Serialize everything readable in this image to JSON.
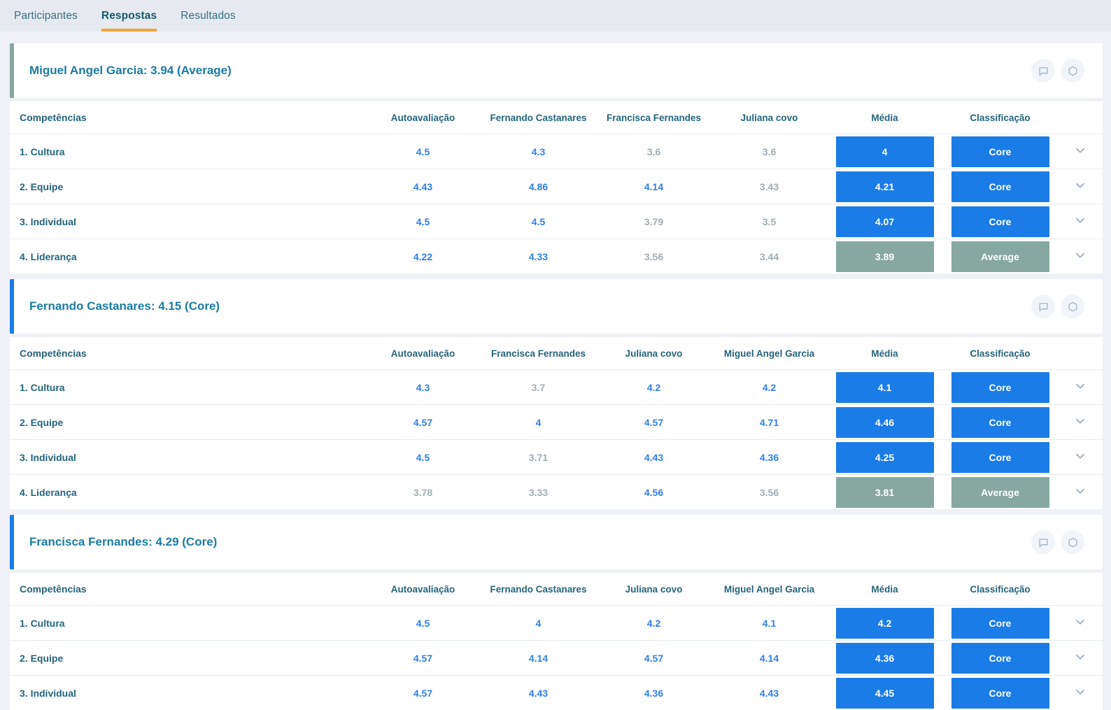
{
  "tab_bar": {
    "tabs": [
      {
        "label": "Participantes",
        "active": false
      },
      {
        "label": "Respostas",
        "active": true
      },
      {
        "label": "Resultados",
        "active": false
      }
    ]
  },
  "colors": {
    "core_blue": "#1b7ce8",
    "average_sage": "#86a8a1",
    "active_tab_underline": "#f6a335",
    "score_high": "#3080e8",
    "score_low": "#9fadb4"
  },
  "sections": [
    {
      "title": "Miguel Angel Garcia: 3.94 (Average)",
      "overall_classification": "Average",
      "header_icons": [
        "comment-icon",
        "hexagon-icon"
      ],
      "columns": {
        "competencias": "Competências",
        "evaluators": [
          "Autoavaliação",
          "Fernando Castanares",
          "Francisca Fernandes",
          "Juliana covo"
        ],
        "media": "Média",
        "classificacao": "Classificação"
      },
      "rows": [
        {
          "label": "1. Cultura",
          "values": [
            4.5,
            4.3,
            3.6,
            3.6
          ],
          "media": 4,
          "classification": "Core"
        },
        {
          "label": "2. Equipe",
          "values": [
            4.43,
            4.86,
            4.14,
            3.43
          ],
          "media": 4.21,
          "classification": "Core"
        },
        {
          "label": "3. Individual",
          "values": [
            4.5,
            4.5,
            3.79,
            3.5
          ],
          "media": 4.07,
          "classification": "Core"
        },
        {
          "label": "4. Liderança",
          "values": [
            4.22,
            4.33,
            3.56,
            3.44
          ],
          "media": 3.89,
          "classification": "Average"
        }
      ]
    },
    {
      "title": "Fernando Castanares: 4.15 (Core)",
      "overall_classification": "Core",
      "header_icons": [
        "comment-icon",
        "hexagon-icon"
      ],
      "columns": {
        "competencias": "Competências",
        "evaluators": [
          "Autoavaliação",
          "Francisca Fernandes",
          "Juliana covo",
          "Miguel Angel Garcia"
        ],
        "media": "Média",
        "classificacao": "Classificação"
      },
      "rows": [
        {
          "label": "1. Cultura",
          "values": [
            4.3,
            3.7,
            4.2,
            4.2
          ],
          "media": 4.1,
          "classification": "Core"
        },
        {
          "label": "2. Equipe",
          "values": [
            4.57,
            4,
            4.57,
            4.71
          ],
          "media": 4.46,
          "classification": "Core"
        },
        {
          "label": "3. Individual",
          "values": [
            4.5,
            3.71,
            4.43,
            4.36
          ],
          "media": 4.25,
          "classification": "Core"
        },
        {
          "label": "4. Liderança",
          "values": [
            3.78,
            3.33,
            4.56,
            3.56
          ],
          "media": 3.81,
          "classification": "Average"
        }
      ]
    },
    {
      "title": "Francisca Fernandes: 4.29 (Core)",
      "overall_classification": "Core",
      "header_icons": [
        "comment-icon",
        "hexagon-icon"
      ],
      "columns": {
        "competencias": "Competências",
        "evaluators": [
          "Autoavaliação",
          "Fernando Castanares",
          "Juliana covo",
          "Miguel Angel Garcia"
        ],
        "media": "Média",
        "classificacao": "Classificação"
      },
      "rows": [
        {
          "label": "1. Cultura",
          "values": [
            4.5,
            4,
            4.2,
            4.1
          ],
          "media": 4.2,
          "classification": "Core"
        },
        {
          "label": "2. Equipe",
          "values": [
            4.57,
            4.14,
            4.57,
            4.14
          ],
          "media": 4.36,
          "classification": "Core"
        },
        {
          "label": "3. Individual",
          "values": [
            4.57,
            4.43,
            4.36,
            4.43
          ],
          "media": 4.45,
          "classification": "Core"
        }
      ]
    }
  ]
}
